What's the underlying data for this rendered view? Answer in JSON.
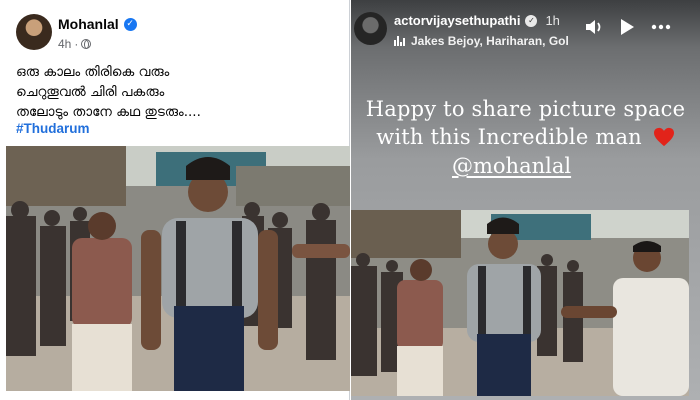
{
  "facebook_post": {
    "author": "Mohanlal",
    "time": "4h",
    "caption_lines": [
      "ഒരു കാലം തിരികെ വരും",
      "ചെറുതൂവൽ ചിരി പകരും",
      "തലോടും താനേ കഥ തുടരും...."
    ],
    "hashtag": "#Thudarum",
    "colors": {
      "verified": "#1877f2",
      "hashtag": "#216fdb"
    }
  },
  "instagram_story": {
    "username": "actorvijaysethupathi",
    "time": "1h",
    "music": "Jakes Bejoy, Hariharan, Gol",
    "text_lines": [
      "Happy to share picture space",
      "with this Incredible man"
    ],
    "mention": "@mohanlal",
    "icons": [
      "music-bars-icon",
      "speaker-icon",
      "play-icon",
      "more-icon",
      "heart-icon"
    ]
  }
}
